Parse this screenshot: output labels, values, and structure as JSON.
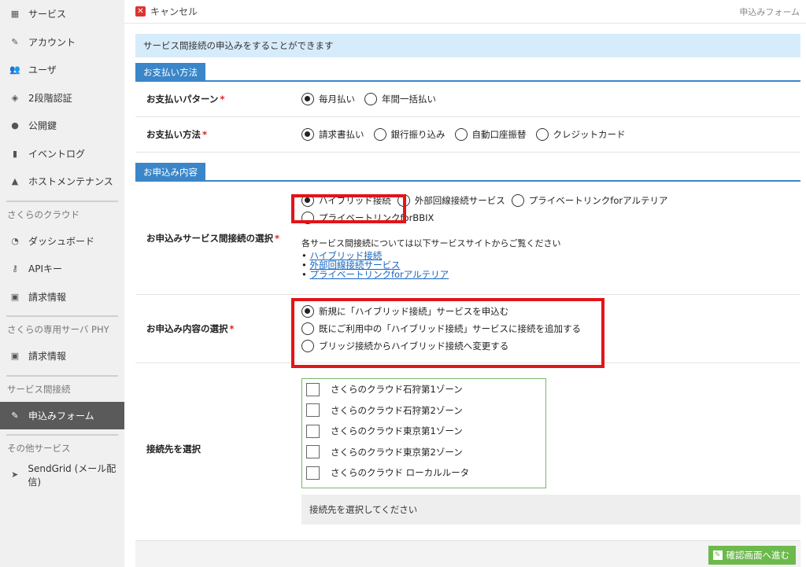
{
  "sidebar": {
    "items_top": [
      {
        "label": "サービス",
        "icon": "grid-icon"
      },
      {
        "label": "アカウント",
        "icon": "pen-icon"
      },
      {
        "label": "ユーザ",
        "icon": "users-icon"
      },
      {
        "label": "2段階認証",
        "icon": "shield-icon"
      },
      {
        "label": "公開鍵",
        "icon": "user-key-icon"
      },
      {
        "label": "イベントログ",
        "icon": "trash-icon"
      },
      {
        "label": "ホストメンテナンス",
        "icon": "warning-icon"
      }
    ],
    "sections": [
      {
        "title": "さくらのクラウド",
        "items": [
          {
            "label": "ダッシュボード",
            "icon": "dashboard-icon"
          },
          {
            "label": "APIキー",
            "icon": "key-icon"
          },
          {
            "label": "請求情報",
            "icon": "money-icon"
          }
        ]
      },
      {
        "title": "さくらの専用サーバ PHY",
        "items": [
          {
            "label": "請求情報",
            "icon": "money-icon"
          }
        ]
      },
      {
        "title": "サービス間接続",
        "items": [
          {
            "label": "申込みフォーム",
            "icon": "pen-icon",
            "active": true
          }
        ]
      },
      {
        "title": "その他サービス",
        "items": [
          {
            "label": "SendGrid (メール配信)",
            "icon": "send-icon"
          }
        ]
      }
    ]
  },
  "topbar": {
    "cancel_label": "キャンセル",
    "title": "申込みフォーム"
  },
  "info": "サービス間接続の申込みをすることができます",
  "payment": {
    "section_title": "お支払い方法",
    "pattern_label": "お支払いパターン",
    "pattern_options": [
      "毎月払い",
      "年間一括払い"
    ],
    "pattern_selected": 0,
    "method_label": "お支払い方法",
    "method_options": [
      "請求書払い",
      "銀行振り込み",
      "自動口座振替",
      "クレジットカード"
    ],
    "method_selected": 0
  },
  "application": {
    "section_title": "お申込み内容",
    "service_label": "お申込みサービス間接続の選択",
    "service_options": [
      "ハイブリッド接続",
      "外部回線接続サービス",
      "プライベートリンクforアルテリア",
      "プライベートリンクforBBIX"
    ],
    "service_selected": 0,
    "service_note": "各サービス間接続については以下サービスサイトからご覧ください",
    "service_links": [
      "ハイブリッド接続",
      "外部回線接続サービス",
      "プライベートリンクforアルテリア"
    ],
    "content_label": "お申込み内容の選択",
    "content_options": [
      "新規に「ハイブリッド接続」サービスを申込む",
      "既にご利用中の「ハイブリッド接続」サービスに接続を追加する",
      "ブリッジ接続からハイブリッド接続へ変更する"
    ],
    "content_selected": 0,
    "dest_label": "接続先を選択",
    "dest_options": [
      "さくらのクラウド石狩第1ゾーン",
      "さくらのクラウド石狩第2ゾーン",
      "さくらのクラウド東京第1ゾーン",
      "さくらのクラウド東京第2ゾーン",
      "さくらのクラウド ローカルルータ"
    ],
    "dest_hint": "接続先を選択してください"
  },
  "footer": {
    "next_label": "確認画面へ進む"
  },
  "colors": {
    "accent": "#3a86c8",
    "highlight": "#e31418",
    "sidebar_active": "#5a5a5a",
    "info_bg": "#d7ecfb",
    "next": "#6cb94c"
  }
}
